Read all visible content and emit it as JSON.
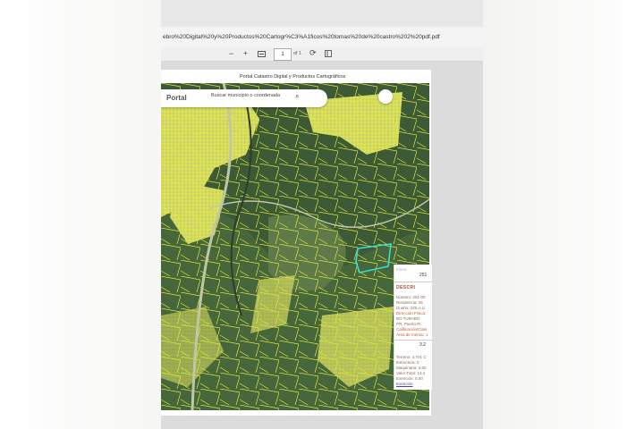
{
  "browser": {
    "url": "ebro%20Digital%20y%20Productos%20Cartogr%C3%A1ficos%20tomas%20de%20castro%202%20pdf.pdf"
  },
  "viewer": {
    "minus": "−",
    "plus": "+",
    "page_number": "1",
    "page_of": "of 1"
  },
  "document": {
    "title": "Portal Catastro Digital y Productos Cartográficos"
  },
  "map": {
    "portal_label": "Portal",
    "search_placeholder": "Buscar municipio o coordenada"
  },
  "info_panel": {
    "top_label": "Finca",
    "top_number": "251",
    "heading": "DESCRI",
    "lines": [
      "Número: 251-00",
      "Residencia: 25",
      "Dueño: SOLA LI",
      "Dirección Física:",
      "BO TURABO",
      "PR, Puerto Ri",
      "Calificación/Clasi",
      "Área de mensu: 1"
    ],
    "mid_number": "3.2",
    "details": [
      "Terreno: 4,701 C",
      "Estructura: 0",
      "Maquinaria: 0.00",
      "Valor Total: 13,4",
      "Exención: 0.00",
      "Exención"
    ]
  }
}
